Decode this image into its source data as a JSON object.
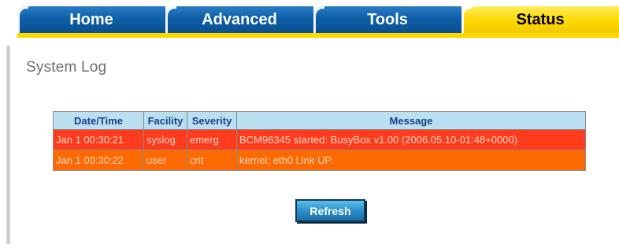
{
  "nav": {
    "tabs": [
      {
        "label": "Home"
      },
      {
        "label": "Advanced"
      },
      {
        "label": "Tools"
      },
      {
        "label": "Status",
        "active": true
      }
    ]
  },
  "page": {
    "title": "System Log"
  },
  "log_table": {
    "headers": [
      "Date/Time",
      "Facility",
      "Severity",
      "Message"
    ],
    "rows": [
      {
        "datetime": "Jan 1 00:30:21",
        "facility": "syslog",
        "severity": "emerg",
        "message": "BCM96345 started: BusyBox v1.00 (2006.05.10-01:48+0000)",
        "row_color": "#ff3b1e"
      },
      {
        "datetime": "Jan 1 00:30:22",
        "facility": "user",
        "severity": "crit",
        "message": "kernel: eth0 Link UP.",
        "row_color": "#ff6a00"
      }
    ]
  },
  "actions": {
    "refresh_label": "Refresh"
  },
  "colors": {
    "tab_blue": "#0f5fa8",
    "tab_active_yellow": "#ffd800",
    "table_header_bg": "#b9dff0",
    "table_header_text": "#1c3f88",
    "button_blue": "#2a8fc9"
  }
}
